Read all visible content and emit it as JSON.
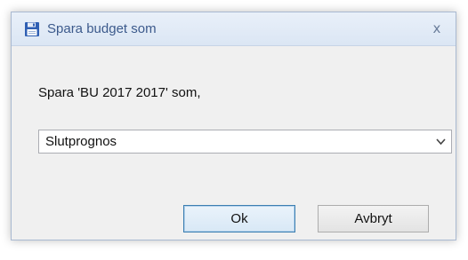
{
  "dialog": {
    "title": "Spara budget som",
    "close_glyph": "x",
    "icon": "floppy-disk-icon",
    "prompt": "Spara 'BU 2017 2017' som,",
    "select": {
      "value": "Slutprognos"
    },
    "buttons": {
      "ok": "Ok",
      "cancel": "Avbryt"
    }
  },
  "colors": {
    "title_text": "#3c5a8c",
    "icon": "#2f5fb3"
  }
}
